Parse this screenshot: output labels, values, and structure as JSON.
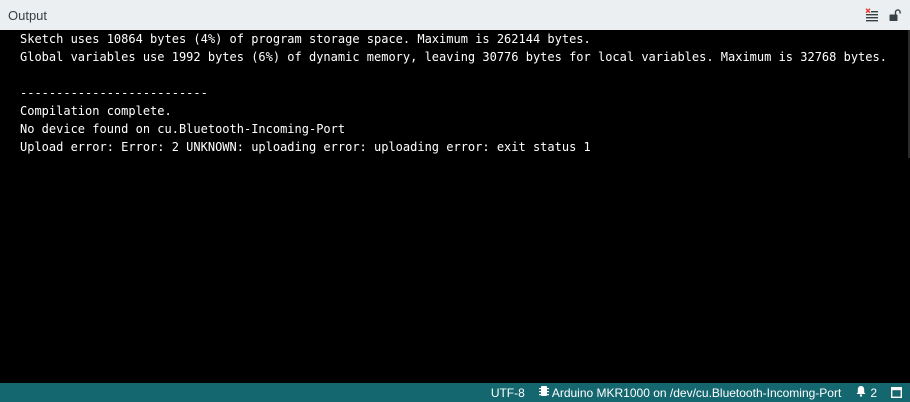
{
  "panel": {
    "title": "Output",
    "actions": [
      {
        "icon": "clear-output-icon"
      },
      {
        "icon": "unlock-icon"
      }
    ]
  },
  "output": {
    "lines": [
      "Sketch uses 10864 bytes (4%) of program storage space. Maximum is 262144 bytes.",
      "Global variables use 1992 bytes (6%) of dynamic memory, leaving 30776 bytes for local variables. Maximum is 32768 bytes.",
      "",
      "--------------------------",
      "Compilation complete.",
      "No device found on cu.Bluetooth-Incoming-Port",
      "Upload error: Error: 2 UNKNOWN: uploading error: uploading error: exit status 1"
    ]
  },
  "status_bar": {
    "encoding": "UTF-8",
    "board": "Arduino MKR1000 on /dev/cu.Bluetooth-Incoming-Port",
    "board_icon": "board-chip-icon",
    "notifications_icon": "bell-icon",
    "notifications_count": "2",
    "layout_icon": "panel-toggle-icon"
  },
  "colors": {
    "header_bg": "#eceff1",
    "output_bg": "#000000",
    "output_text": "#ffffff",
    "status_bg": "#14676f",
    "clear_icon_accent": "#e53935"
  }
}
